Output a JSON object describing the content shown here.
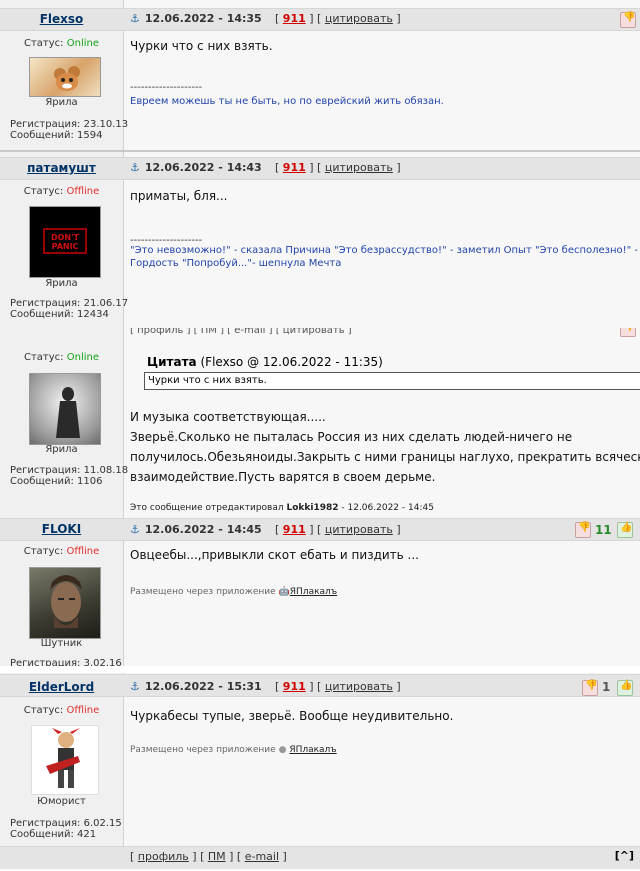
{
  "posts": [
    {
      "nick": "Flexso",
      "date": "12.06.2022 - 14:35",
      "num": "911",
      "quote": "цитировать",
      "status_label": "Статус:",
      "status": "Online",
      "rank": "Ярила",
      "reg": "Регистрация: 23.10.13",
      "msgs": "Сообщений: 1594",
      "text": "Чурки что с них взять.",
      "sigline": "--------------------",
      "sig": "Евреем можешь ты не быть, но по еврейский жить обязан."
    },
    {
      "nick": "патамушт",
      "date": "12.06.2022 - 14:43",
      "num": "911",
      "quote": "цитировать",
      "status_label": "Статус:",
      "status": "Offline",
      "rank": "Ярила",
      "reg": "Регистрация: 21.06.17",
      "msgs": "Сообщений: 12434",
      "text": "приматы, бля...",
      "sigline": "--------------------",
      "sig1": "\"Это невозможно!\" - сказала Причина \"Это безрассудство!\" - заметил Опыт \"Это бесполезно!\" - отрезала",
      "sig2": "Гордость \"Попробуй...\"- шепнула Мечта"
    },
    {
      "header_fragment": "[ профиль ] [ ПМ ] [ e-mail ] [ цитировать ]",
      "status_label": "Статус:",
      "status": "Online",
      "rank": "Ярила",
      "reg": "Регистрация: 11.08.18",
      "msgs": "Сообщений: 1106",
      "quote_label": "Цитата",
      "quote_meta": "(Flexso @ 12.06.2022 - 11:35)",
      "quote_text": "Чурки что с них взять.",
      "lines": [
        "И музыка соответствующая.....",
        "Зверьё.Сколько не пыталась Россия из них сделать людей-ничего не",
        "получилось.Обезьяноиды.Закрыть с ними границы наглухо, прекратить всяческое",
        "взаимодействие.Пусть варятся в своем дерьме."
      ],
      "edited_prefix": "Это сообщение отредактировал",
      "edited_user": "Lokki1982",
      "edited_date": "- 12.06.2022 - 14:45"
    },
    {
      "nick": "FLOKI",
      "date": "12.06.2022 - 14:45",
      "num": "911",
      "quote": "цитировать",
      "status_label": "Статус:",
      "status": "Offline",
      "rank": "Шутник",
      "reg": "Регистрация: 3.02.16",
      "votes": "11",
      "text": "Овцеебы...,привыкли скот ебать и пиздить ...",
      "via": "Размещено через приложение",
      "app": "ЯПлакалъ"
    },
    {
      "nick": "ElderLord",
      "date": "12.06.2022 - 15:31",
      "num": "911",
      "quote": "цитировать",
      "status_label": "Статус:",
      "status": "Offline",
      "rank": "Юморист",
      "reg": "Регистрация: 6.02.15",
      "msgs": "Сообщений: 421",
      "votes": "1",
      "text": "Чуркабесы тупые, зверьё. Вообще неудивительно.",
      "via": "Размещено через приложение",
      "app": "ЯПлакалъ"
    }
  ],
  "footer": {
    "profile": "профиль",
    "pm": "ПМ",
    "email": "e-mail",
    "top": "[^]"
  },
  "colors": {
    "online": "#16a316",
    "offline": "#e03030",
    "accent_red": "#d00000",
    "signature": "#2244aa"
  },
  "icons": [
    "anchor-icon",
    "thumbs-down-icon",
    "thumbs-up-icon",
    "android-icon",
    "apple-icon"
  ]
}
